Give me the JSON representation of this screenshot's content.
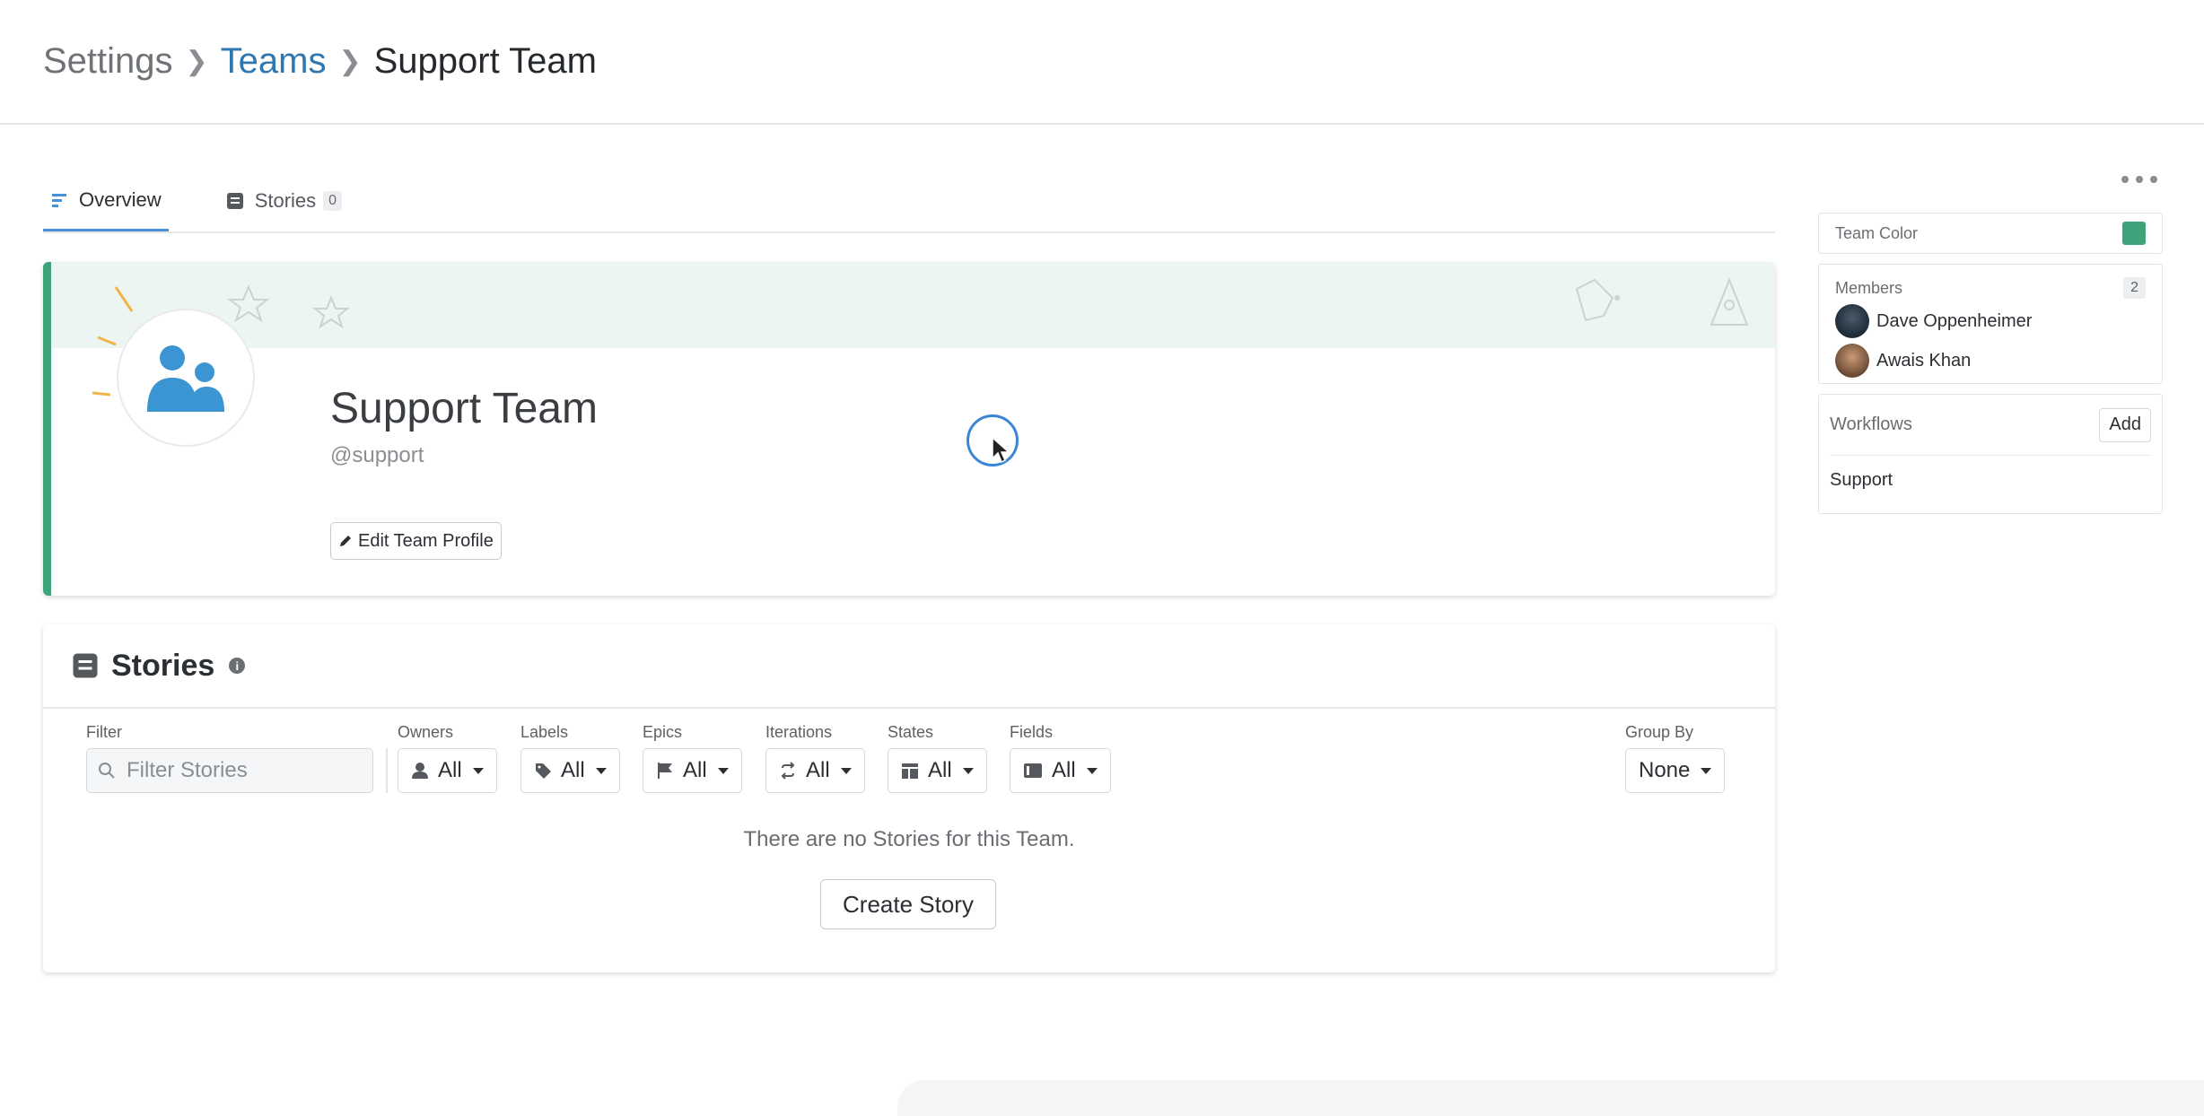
{
  "breadcrumb": {
    "settings": "Settings",
    "teams": "Teams",
    "current": "Support Team"
  },
  "tabs": [
    {
      "label": "Overview",
      "icon": "overview-icon"
    },
    {
      "label": "Stories",
      "count": "0",
      "icon": "stories-icon"
    }
  ],
  "profile": {
    "name": "Support Team",
    "handle": "@support",
    "edit_label": "Edit Team Profile",
    "accent_color": "#3ea37b"
  },
  "stories": {
    "title": "Stories",
    "filter": {
      "label": "Filter",
      "placeholder": "Filter Stories"
    },
    "filters": [
      {
        "label": "Owners",
        "value": "All",
        "icon": "person-icon"
      },
      {
        "label": "Labels",
        "value": "All",
        "icon": "tag-icon"
      },
      {
        "label": "Epics",
        "value": "All",
        "icon": "flag-icon"
      },
      {
        "label": "Iterations",
        "value": "All",
        "icon": "iteration-icon"
      },
      {
        "label": "States",
        "value": "All",
        "icon": "states-icon"
      },
      {
        "label": "Fields",
        "value": "All",
        "icon": "fields-icon"
      }
    ],
    "group_by": {
      "label": "Group By",
      "value": "None"
    },
    "empty_message": "There are no Stories for this Team.",
    "create_label": "Create Story"
  },
  "sidebar": {
    "team_color": {
      "label": "Team Color",
      "color": "#3ea37b"
    },
    "members": {
      "label": "Members",
      "count": "2",
      "list": [
        {
          "name": "Dave Oppenheimer"
        },
        {
          "name": "Awais Khan"
        }
      ]
    },
    "workflows": {
      "label": "Workflows",
      "add_label": "Add",
      "items": [
        "Support"
      ]
    }
  }
}
